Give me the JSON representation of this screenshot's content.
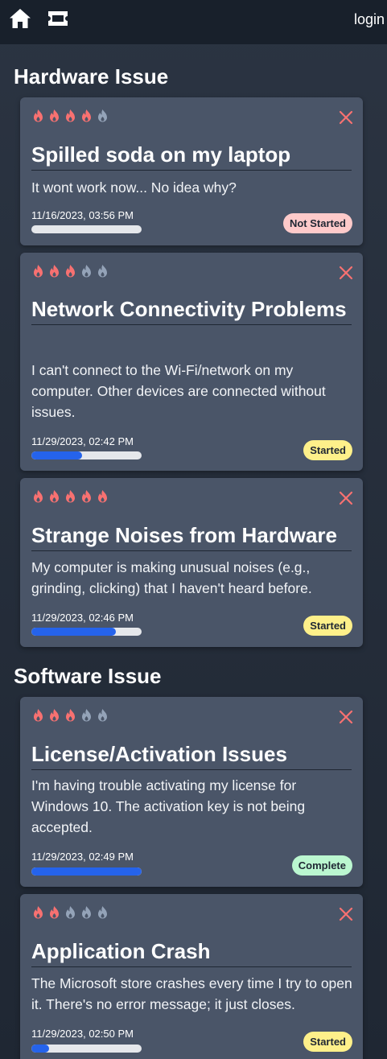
{
  "nav": {
    "home_icon": "home-icon",
    "ticket_icon": "ticket-icon",
    "login_label": "login"
  },
  "colors": {
    "flame_active": "#f87171",
    "flame_inactive": "#94a3b8",
    "close": "#f87171",
    "progress_fill": "#2563eb",
    "badge_not_started": "#fecaca",
    "badge_started": "#fef08a",
    "badge_complete": "#bbf7d0"
  },
  "sections": [
    {
      "title": "Hardware Issue",
      "tickets": [
        {
          "priority": 4,
          "title": "Spilled soda on my laptop",
          "description": "It wont work now... No idea why?",
          "date": "11/16/2023, 03:56 PM",
          "progress": 0,
          "status": "Not Started"
        },
        {
          "priority": 3,
          "title": "Network Connectivity Problems",
          "description": "I can't connect to the Wi-Fi/network on my computer. Other devices are connected without issues.",
          "date": "11/29/2023, 02:42 PM",
          "progress": 0.46,
          "status": "Started"
        },
        {
          "priority": 5,
          "title": "Strange Noises from Hardware",
          "description": "My computer is making unusual noises (e.g., grinding, clicking) that I haven't heard before.",
          "date": "11/29/2023, 02:46 PM",
          "progress": 0.77,
          "status": "Started"
        }
      ]
    },
    {
      "title": "Software Issue",
      "tickets": [
        {
          "priority": 3,
          "title": "License/Activation Issues",
          "description": "I'm having trouble activating my license for Windows 10. The activation key is not being accepted.",
          "date": "11/29/2023, 02:49 PM",
          "progress": 1,
          "status": "Complete"
        },
        {
          "priority": 2,
          "title": "Application Crash",
          "description": "The Microsoft store crashes every time I try to open it. There's no error message; it just closes.",
          "date": "11/29/2023, 02:50 PM",
          "progress": 0.16,
          "status": "Started"
        }
      ]
    }
  ]
}
